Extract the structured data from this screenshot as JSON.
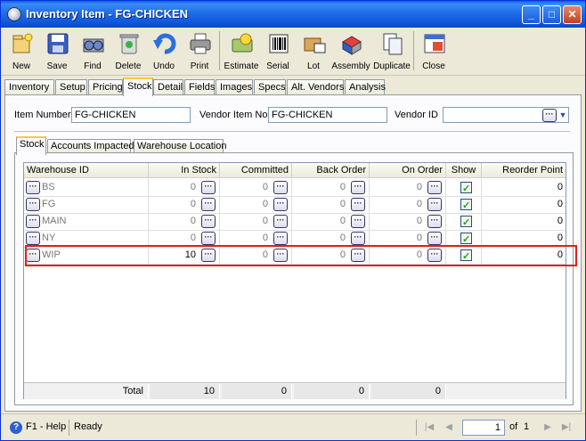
{
  "window": {
    "title": "Inventory Item - FG-CHICKEN",
    "controls": [
      "_",
      "□",
      "✕"
    ]
  },
  "toolbar": {
    "buttons": [
      {
        "label": "New",
        "icon": "new-icon"
      },
      {
        "label": "Save",
        "icon": "save-icon"
      },
      {
        "label": "Find",
        "icon": "find-icon"
      },
      {
        "label": "Delete",
        "icon": "delete-icon"
      },
      {
        "label": "Undo",
        "icon": "undo-icon"
      },
      {
        "label": "Print",
        "icon": "print-icon"
      },
      {
        "label": "Estimate",
        "icon": "estimate-icon"
      },
      {
        "label": "Serial",
        "icon": "serial-icon"
      },
      {
        "label": "Lot",
        "icon": "lot-icon"
      },
      {
        "label": "Assembly",
        "icon": "assembly-icon"
      },
      {
        "label": "Duplicate",
        "icon": "duplicate-icon"
      },
      {
        "label": "Close",
        "icon": "close-icon"
      }
    ]
  },
  "tabs": [
    "Inventory",
    "Setup",
    "Pricing",
    "Stock",
    "Detail",
    "Fields",
    "Images",
    "Specs",
    "Alt. Vendors",
    "Analysis"
  ],
  "active_tab": "Stock",
  "form": {
    "item_number_label": "Item Number",
    "item_number": "FG-CHICKEN",
    "vendor_item_no_label": "Vendor Item No",
    "vendor_item_no": "FG-CHICKEN",
    "vendor_id_label": "Vendor ID",
    "vendor_id": ""
  },
  "subtabs": [
    "Stock",
    "Accounts Impacted",
    "Warehouse Location"
  ],
  "active_subtab": "Stock",
  "grid": {
    "columns": [
      "Warehouse ID",
      "In Stock",
      "Committed",
      "Back Order",
      "On Order",
      "Show",
      "Reorder Point"
    ],
    "rows": [
      {
        "warehouse": "BS",
        "in_stock": "0",
        "committed": "0",
        "back_order": "0",
        "on_order": "0",
        "show": true,
        "reorder_point": "0"
      },
      {
        "warehouse": "FG",
        "in_stock": "0",
        "committed": "0",
        "back_order": "0",
        "on_order": "0",
        "show": true,
        "reorder_point": "0"
      },
      {
        "warehouse": "MAIN",
        "in_stock": "0",
        "committed": "0",
        "back_order": "0",
        "on_order": "0",
        "show": true,
        "reorder_point": "0"
      },
      {
        "warehouse": "NY",
        "in_stock": "0",
        "committed": "0",
        "back_order": "0",
        "on_order": "0",
        "show": true,
        "reorder_point": "0"
      },
      {
        "warehouse": "WIP",
        "in_stock": "10",
        "committed": "0",
        "back_order": "0",
        "on_order": "0",
        "show": true,
        "reorder_point": "0"
      }
    ],
    "selected_row": 4,
    "totals": {
      "label": "Total",
      "in_stock": "10",
      "committed": "0",
      "back_order": "0",
      "on_order": "0"
    }
  },
  "status": {
    "help": "F1 - Help",
    "state": "Ready",
    "page": "1",
    "of_label": "of",
    "total_pages": "1"
  },
  "colors": {
    "titlebar": "#0a5fe6",
    "selection_border": "#e02020",
    "active_tab_accent": "#ffc83c"
  }
}
